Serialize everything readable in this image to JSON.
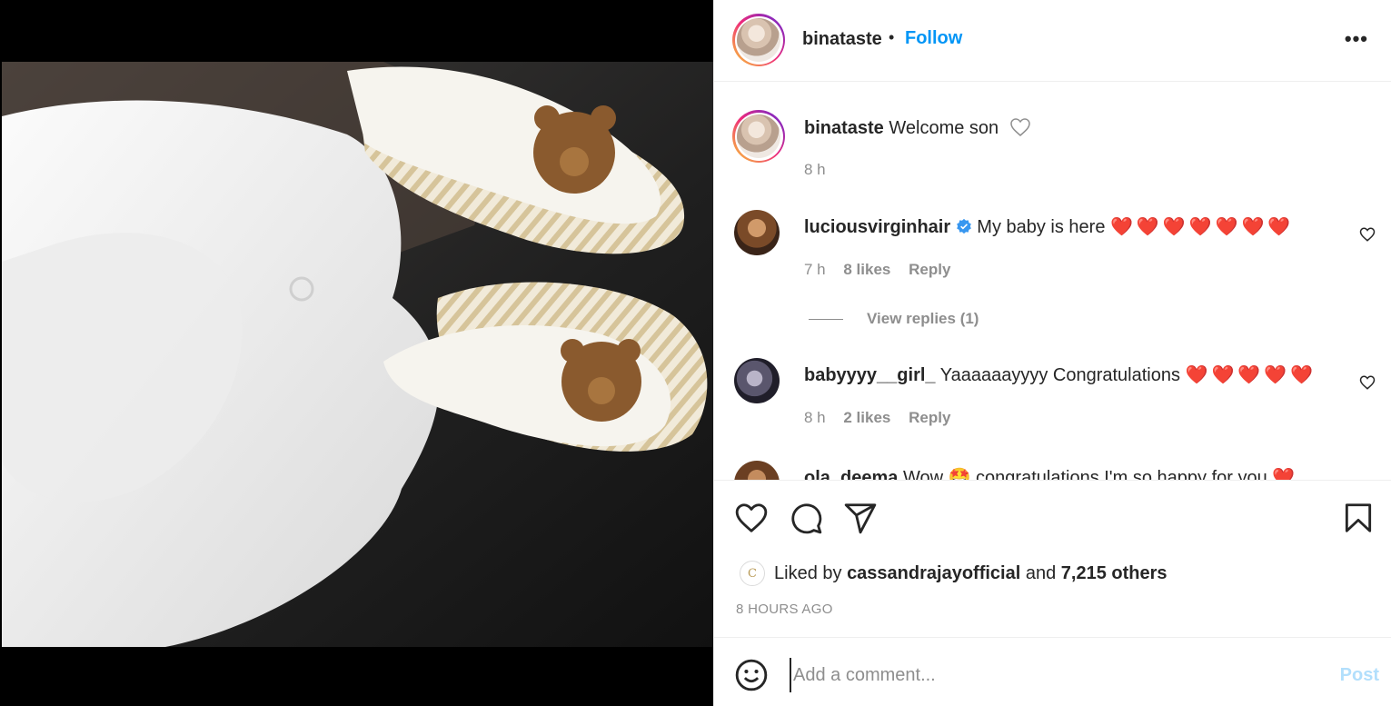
{
  "post": {
    "username": "binataste",
    "follow_label": "Follow",
    "more_label": "•••"
  },
  "caption": {
    "username": "binataste",
    "text": "Welcome son",
    "time": "8 h"
  },
  "comments": [
    {
      "username": "luciousvirginhair",
      "verified": true,
      "text": "My baby is here",
      "hearts": "❤️❤️❤️❤️❤️❤️❤️",
      "time": "7 h",
      "likes": "8 likes",
      "reply_label": "Reply",
      "view_replies": "View replies (1)"
    },
    {
      "username": "babyyyy__girl_",
      "text": "Yaaaaaayyyy Congratulations",
      "hearts": "❤️❤️❤️❤️❤️",
      "time": "8 h",
      "likes": "2 likes",
      "reply_label": "Reply"
    },
    {
      "username": "ola_deema",
      "text": "Wow 🤩 congratulations I'm so happy for you ❤️"
    }
  ],
  "likes": {
    "prefix": "Liked by",
    "user": "cassandrajayofficial",
    "connector": "and",
    "others": "7,215 others",
    "avatar_initial": "C"
  },
  "timestamp": "8 HOURS AGO",
  "comment_box": {
    "placeholder": "Add a comment...",
    "post_label": "Post"
  },
  "colors": {
    "link_blue": "#0095f6",
    "post_disabled": "#b2dffc",
    "heart_red": "#e0142a",
    "muted": "#8e8e8e"
  }
}
